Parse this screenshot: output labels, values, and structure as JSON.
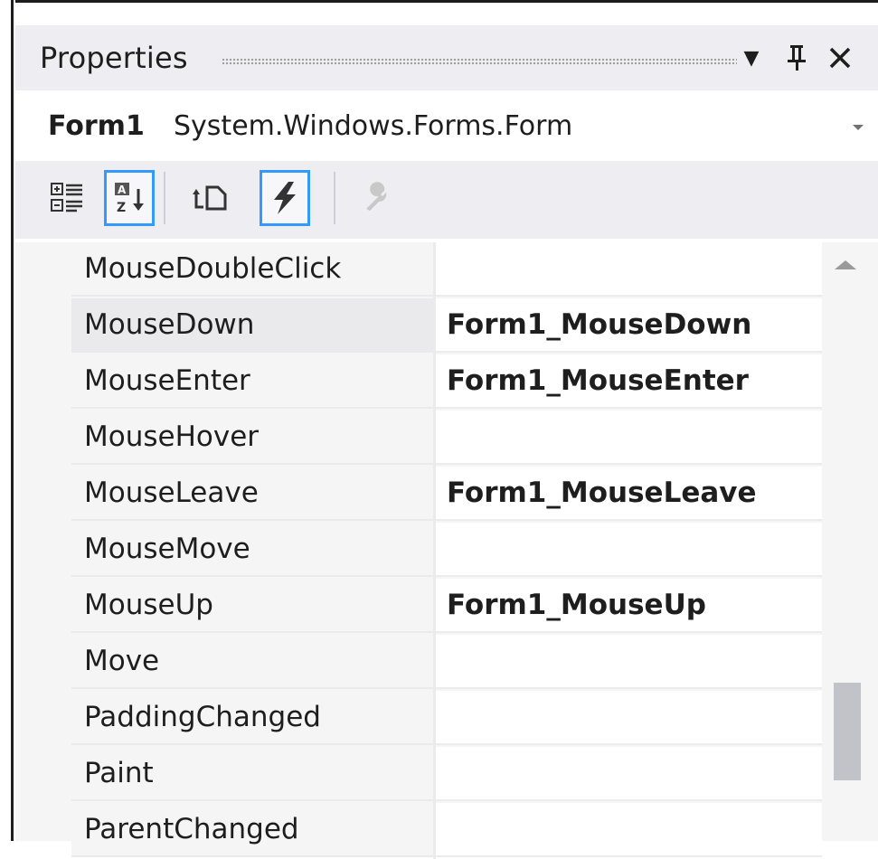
{
  "panel": {
    "title": "Properties",
    "buttons": {
      "dropdown_glyph": "▼",
      "pin_glyph": "ᵻ",
      "close_glyph": "✕"
    }
  },
  "selector": {
    "object_name": "Form1",
    "object_type": "System.Windows.Forms.Form"
  },
  "toolbar": {
    "buttons": [
      {
        "name": "categorized-icon",
        "active": false
      },
      {
        "name": "alphabetical-icon",
        "active": true
      },
      {
        "name": "properties-icon",
        "active": false
      },
      {
        "name": "events-icon",
        "active": true
      },
      {
        "name": "property-pages-icon",
        "active": false,
        "disabled": true
      }
    ]
  },
  "events": [
    {
      "name": "MouseDoubleClick",
      "handler": ""
    },
    {
      "name": "MouseDown",
      "handler": "Form1_MouseDown"
    },
    {
      "name": "MouseEnter",
      "handler": "Form1_MouseEnter"
    },
    {
      "name": "MouseHover",
      "handler": ""
    },
    {
      "name": "MouseLeave",
      "handler": "Form1_MouseLeave"
    },
    {
      "name": "MouseMove",
      "handler": ""
    },
    {
      "name": "MouseUp",
      "handler": "Form1_MouseUp"
    },
    {
      "name": "Move",
      "handler": ""
    },
    {
      "name": "PaddingChanged",
      "handler": ""
    },
    {
      "name": "Paint",
      "handler": ""
    },
    {
      "name": "ParentChanged",
      "handler": ""
    }
  ],
  "selected_event": "MouseDown",
  "scrollbar": {
    "position": 0.77
  },
  "colors": {
    "accent": "#3399ff",
    "background": "#eeeef2"
  }
}
